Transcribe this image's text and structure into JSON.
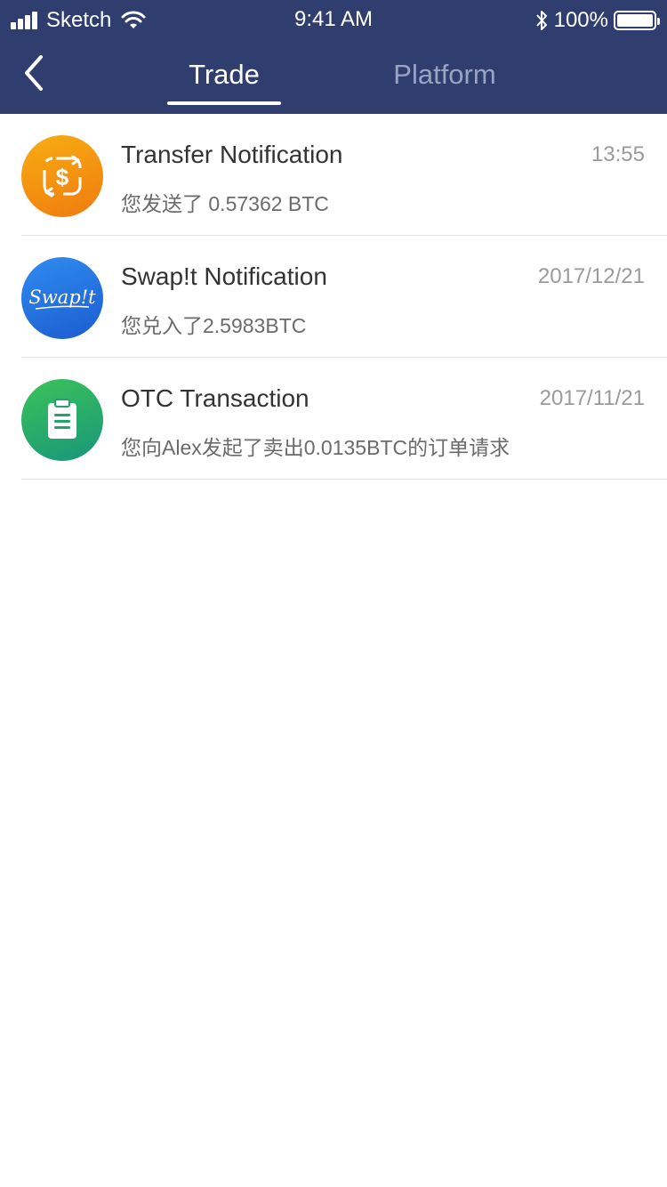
{
  "status_bar": {
    "carrier": "Sketch",
    "time": "9:41 AM",
    "battery": "100%"
  },
  "nav": {
    "tabs": [
      {
        "label": "Trade",
        "active": true
      },
      {
        "label": "Platform",
        "active": false
      }
    ]
  },
  "notifications": [
    {
      "icon": "dollar-exchange-icon",
      "title": "Transfer Notification",
      "time": "13:55",
      "message": "您发送了 0.57362 BTC",
      "color": "#f39a10"
    },
    {
      "icon": "swapit-logo-icon",
      "title": "Swap!t Notification",
      "time": "2017/12/21",
      "message": "您兑入了2.5983BTC",
      "color": "#2574e0",
      "logo_text": "Swap!t"
    },
    {
      "icon": "clipboard-icon",
      "title": "OTC Transaction",
      "time": "2017/11/21",
      "message": "您向Alex发起了卖出0.0135BTC的订单请求",
      "color": "#28ad6a"
    }
  ],
  "colors": {
    "header_bg": "#2f3e6e",
    "tab_inactive": "#9aa3c2"
  }
}
